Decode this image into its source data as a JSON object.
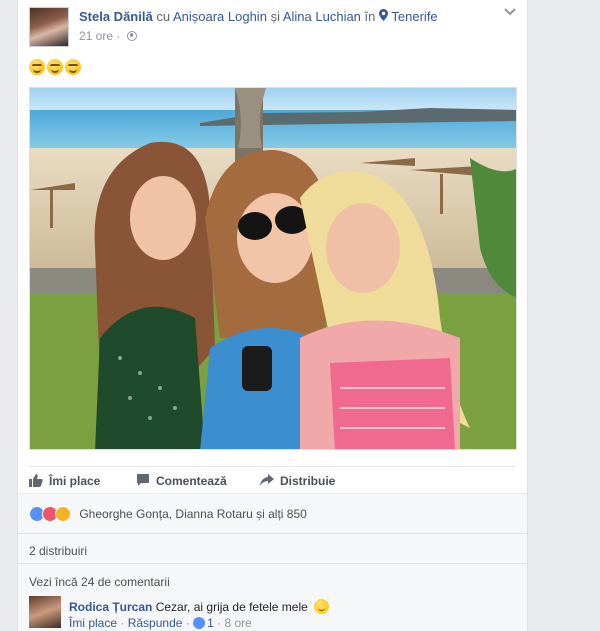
{
  "post": {
    "author": "Stela Dănilă",
    "with_text": "cu",
    "tagged_1": "Anișoara Loghin",
    "and_text": "și",
    "tagged_2": "Alina Luchian",
    "in_text": "în",
    "location": "Tenerife",
    "time": "21 ore",
    "separator": "·",
    "emoji_count": 3
  },
  "actions": {
    "like": "Îmi place",
    "comment": "Comentează",
    "share": "Distribuie"
  },
  "reactions": {
    "text": "Gheorghe Gonța, Dianna Rotaru și alți 850",
    "icons": [
      "like-icon",
      "love-icon",
      "wow-icon"
    ]
  },
  "shares": {
    "text": "2 distribuiri"
  },
  "comments": {
    "view_more": "Vezi încă 24 de comentarii",
    "items": [
      {
        "author": "Rodica Țurcan",
        "text": "Cezar, ai grija de fetele mele",
        "like_label": "Îmi place",
        "reply_label": "Răspunde",
        "likes": "1",
        "time": "8 ore"
      }
    ]
  },
  "colors": {
    "link": "#365899",
    "like_blue": "#5890ff",
    "love_red": "#f25268",
    "wow_yellow": "#f7b125"
  }
}
